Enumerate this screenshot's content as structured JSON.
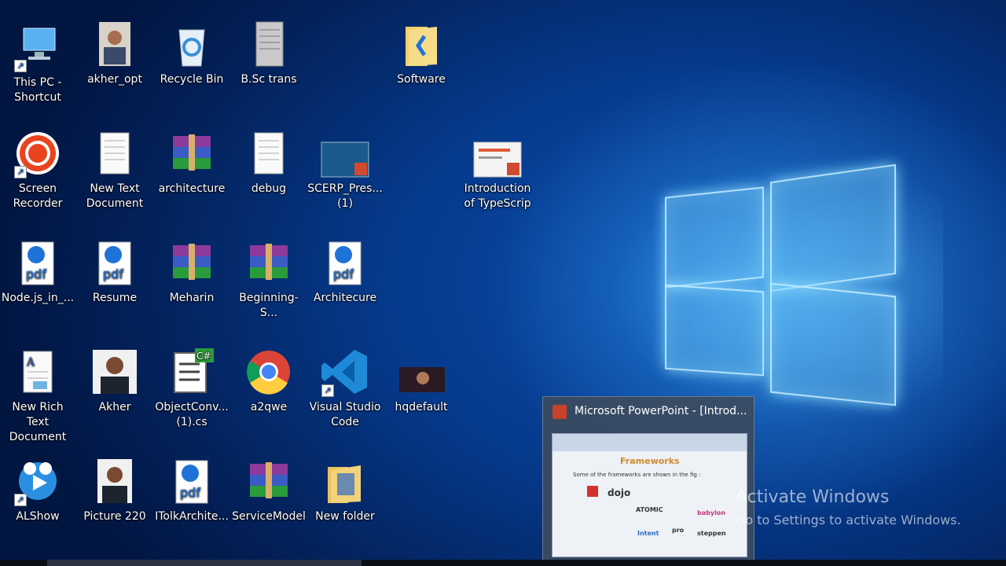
{
  "desktop": {
    "icons": [
      {
        "label": "This PC - Shortcut",
        "icon": "computer-icon"
      },
      {
        "label": "akher_opt",
        "icon": "photo-icon"
      },
      {
        "label": "Recycle Bin",
        "icon": "recycle-bin-icon"
      },
      {
        "label": "B.Sc trans",
        "icon": "document-scan-icon"
      },
      {
        "label": "Software",
        "icon": "folder-icon"
      },
      {
        "label": "Screen Recorder",
        "icon": "recorder-icon"
      },
      {
        "label": "New Text Document",
        "icon": "text-document-icon"
      },
      {
        "label": "architecture",
        "icon": "winrar-archive-icon"
      },
      {
        "label": "debug",
        "icon": "text-document-icon"
      },
      {
        "label": "SCERP_Pres... (1)",
        "icon": "powerpoint-file-icon"
      },
      {
        "label": "Introduction of TypeScrip",
        "icon": "powerpoint-file-icon"
      },
      {
        "label": "Node.js_in_...",
        "icon": "pdf-icon"
      },
      {
        "label": "Resume",
        "icon": "pdf-icon"
      },
      {
        "label": "Meharin",
        "icon": "winrar-archive-icon"
      },
      {
        "label": "Beginning-S...",
        "icon": "winrar-archive-icon"
      },
      {
        "label": "Architecure",
        "icon": "pdf-icon"
      },
      {
        "label": "New Rich Text Document",
        "icon": "rich-text-document-icon"
      },
      {
        "label": "Akher",
        "icon": "photo-icon"
      },
      {
        "label": "ObjectConv... (1).cs",
        "icon": "csharp-file-icon"
      },
      {
        "label": "a2qwe",
        "icon": "chrome-icon"
      },
      {
        "label": "Visual Studio Code",
        "icon": "vscode-icon"
      },
      {
        "label": "hqdefault",
        "icon": "image-icon"
      },
      {
        "label": "ALShow",
        "icon": "alshow-icon"
      },
      {
        "label": "Picture 220",
        "icon": "photo-icon"
      },
      {
        "label": "ITolkArchite...",
        "icon": "pdf-icon"
      },
      {
        "label": "ServiceModel",
        "icon": "winrar-archive-icon"
      },
      {
        "label": "New folder",
        "icon": "folder-icon"
      }
    ]
  },
  "taskbar_preview": {
    "title": "Microsoft PowerPoint - [Introd...",
    "slide_heading": "Frameworks",
    "slide_bullet": "Some of the frameworks are shown in the fig :",
    "framework_logos": [
      "dojo",
      "ATOMIC",
      "pro",
      "Intent",
      "babylon",
      "steppen"
    ]
  },
  "watermark": {
    "title": "Activate Windows",
    "subtitle": "Go to Settings to activate Windows."
  },
  "colors": {
    "accent": "#0a4fb0",
    "preview_bg": "#3c4b5f"
  }
}
